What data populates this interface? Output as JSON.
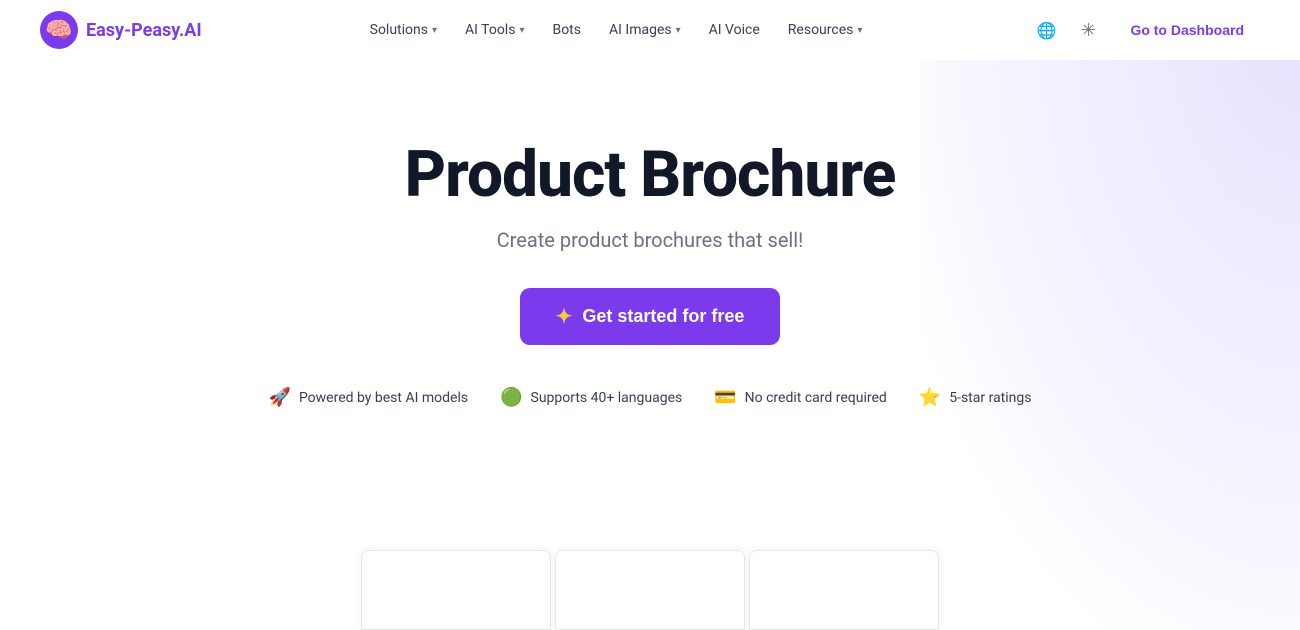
{
  "logo": {
    "icon": "🧠",
    "text_part1": "Easy-Peasy.",
    "text_part2": "AI"
  },
  "nav": {
    "items": [
      {
        "label": "Solutions",
        "hasDropdown": true
      },
      {
        "label": "AI Tools",
        "hasDropdown": true
      },
      {
        "label": "Bots",
        "hasDropdown": false
      },
      {
        "label": "AI Images",
        "hasDropdown": true
      },
      {
        "label": "AI Voice",
        "hasDropdown": false
      },
      {
        "label": "Resources",
        "hasDropdown": true
      }
    ],
    "globe_icon": "🌐",
    "theme_icon": "☀",
    "dashboard_label": "Go to Dashboard"
  },
  "hero": {
    "title": "Product Brochure",
    "subtitle": "Create product brochures that sell!",
    "cta_label": "Get started for free",
    "cta_icon": "✦"
  },
  "features": [
    {
      "icon": "🚀",
      "text": "Powered by best AI models"
    },
    {
      "icon": "🟢",
      "text": "Supports 40+ languages"
    },
    {
      "icon": "💳",
      "text": "No credit card required"
    },
    {
      "icon": "⭐",
      "text": "5-star ratings"
    }
  ]
}
